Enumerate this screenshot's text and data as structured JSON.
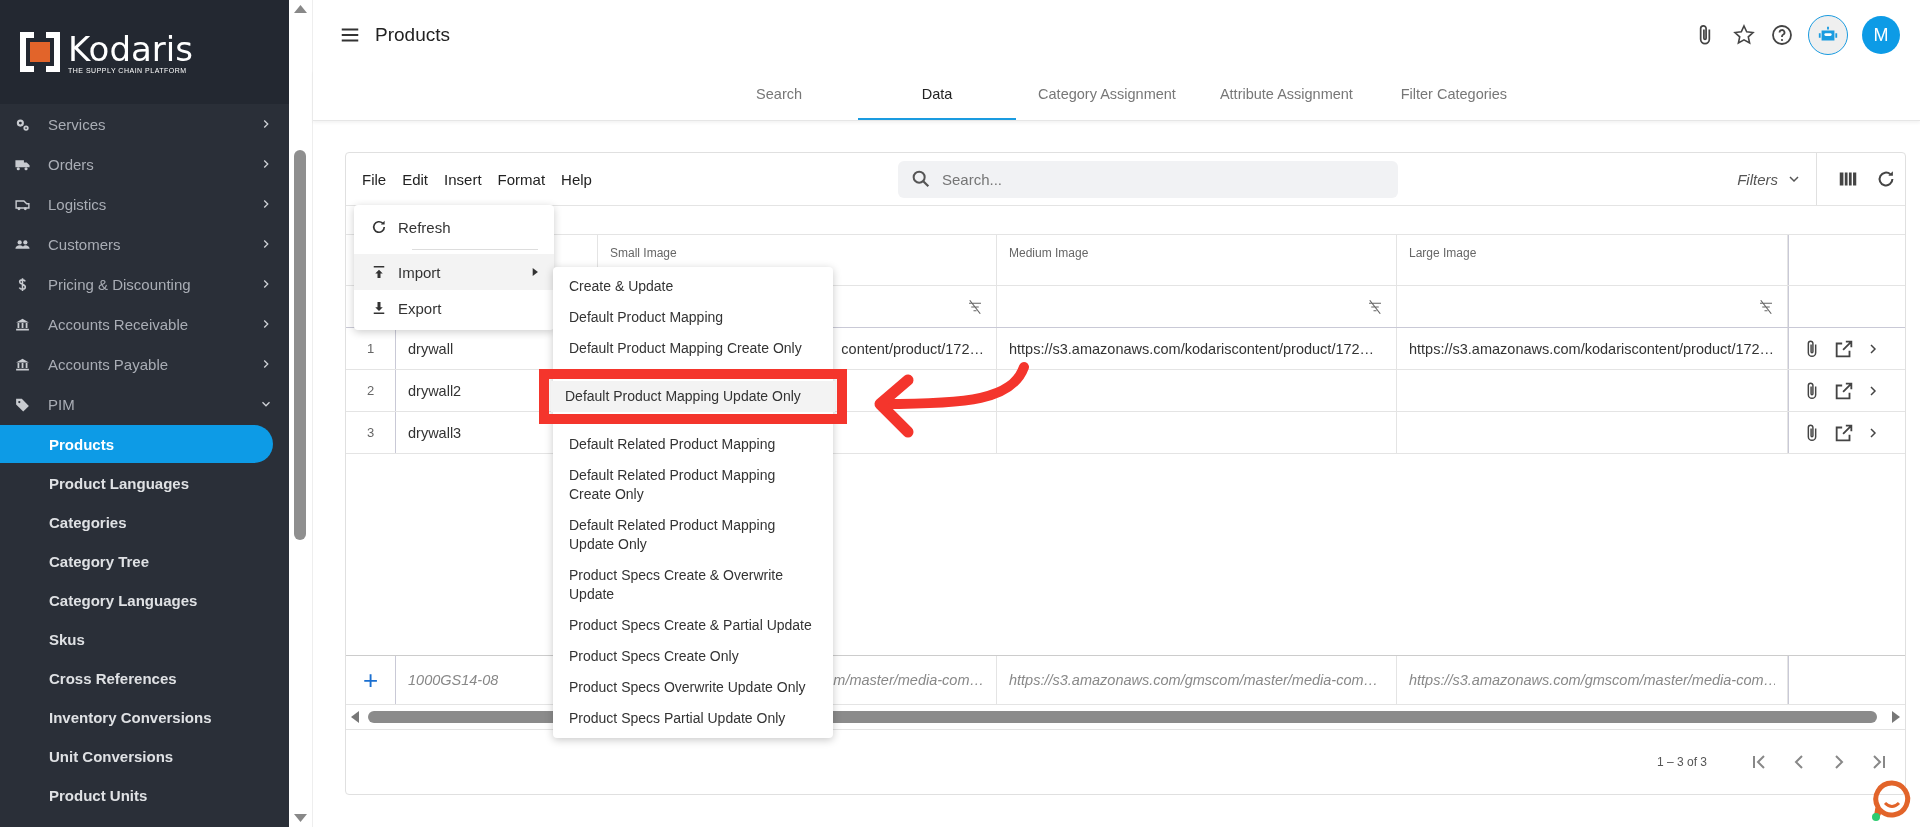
{
  "sidebar": {
    "logo": {
      "name": "Kodaris",
      "tagline": "THE SUPPLY CHAIN PLATFORM"
    },
    "items": [
      {
        "label": "Services",
        "expanded": false
      },
      {
        "label": "Orders",
        "expanded": false
      },
      {
        "label": "Logistics",
        "expanded": false
      },
      {
        "label": "Customers",
        "expanded": false
      },
      {
        "label": "Pricing & Discounting",
        "expanded": false
      },
      {
        "label": "Accounts Receivable",
        "expanded": false
      },
      {
        "label": "Accounts Payable",
        "expanded": false
      },
      {
        "label": "PIM",
        "expanded": true,
        "children": [
          {
            "label": "Products",
            "selected": true
          },
          {
            "label": "Product Languages",
            "selected": false
          },
          {
            "label": "Categories",
            "selected": false
          },
          {
            "label": "Category Tree",
            "selected": false
          },
          {
            "label": "Category Languages",
            "selected": false
          },
          {
            "label": "Skus",
            "selected": false
          },
          {
            "label": "Cross References",
            "selected": false
          },
          {
            "label": "Inventory Conversions",
            "selected": false
          },
          {
            "label": "Unit Conversions",
            "selected": false
          },
          {
            "label": "Product Units",
            "selected": false
          }
        ]
      }
    ]
  },
  "header": {
    "title": "Products",
    "avatar": "M"
  },
  "tabs": [
    {
      "label": "Search",
      "selected": false
    },
    {
      "label": "Data",
      "selected": true
    },
    {
      "label": "Category Assignment",
      "selected": false
    },
    {
      "label": "Attribute Assignment",
      "selected": false
    },
    {
      "label": "Filter Categories",
      "selected": false
    }
  ],
  "toolbar": {
    "menus": [
      "File",
      "Edit",
      "Insert",
      "Format",
      "Help"
    ],
    "search": {
      "placeholder": "Search..."
    },
    "filters": "Filters"
  },
  "file_menu": {
    "items": [
      {
        "label": "Refresh",
        "highlighted": false,
        "submenu": false
      },
      {
        "label": "Import",
        "highlighted": true,
        "submenu": true
      },
      {
        "label": "Export",
        "highlighted": false,
        "submenu": false
      }
    ]
  },
  "import_submenu": {
    "items": [
      {
        "label": "Create & Update",
        "highlighted": false,
        "boxed": false
      },
      {
        "label": "Default Product Mapping",
        "highlighted": false,
        "boxed": false
      },
      {
        "label": "Default Product Mapping Create Only",
        "highlighted": false,
        "boxed": false
      },
      {
        "label": "Default Product Mapping Update Only",
        "highlighted": true,
        "boxed": true
      },
      {
        "label": "Default Related Product Mapping",
        "highlighted": false,
        "boxed": false
      },
      {
        "label": "Default Related Product Mapping Create Only",
        "highlighted": false,
        "boxed": false
      },
      {
        "label": "Default Related Product Mapping Update Only",
        "highlighted": false,
        "boxed": false
      },
      {
        "label": "Product Specs Create & Overwrite Update",
        "highlighted": false,
        "boxed": false
      },
      {
        "label": "Product Specs Create & Partial Update",
        "highlighted": false,
        "boxed": false
      },
      {
        "label": "Product Specs Create Only",
        "highlighted": false,
        "boxed": false
      },
      {
        "label": "Product Specs Overwrite Update Only",
        "highlighted": false,
        "boxed": false
      },
      {
        "label": "Product Specs Partial Update Only",
        "highlighted": false,
        "boxed": false
      }
    ]
  },
  "table": {
    "columns": [
      "Small Image",
      "Medium Image",
      "Large Image"
    ],
    "rows": [
      {
        "number": "1",
        "sku": "drywall",
        "small_image": "content/product/172…",
        "medium_image": "https://s3.amazonaws.com/kodariscontent/product/172…",
        "large_image": "https://s3.amazonaws.com/kodariscontent/product/172…"
      },
      {
        "number": "2",
        "sku": "drywall2"
      },
      {
        "number": "3",
        "sku": "drywall3"
      }
    ],
    "new_row": {
      "add": "+",
      "sku": "1000GS14-08",
      "small_image": "m/master/media-com…",
      "medium_image": "https://s3.amazonaws.com/gmscom/master/media-com…",
      "large_image": "https://s3.amazonaws.com/gmscom/master/media-com…"
    }
  },
  "pagination": {
    "range": "1 – 3 of 3"
  }
}
